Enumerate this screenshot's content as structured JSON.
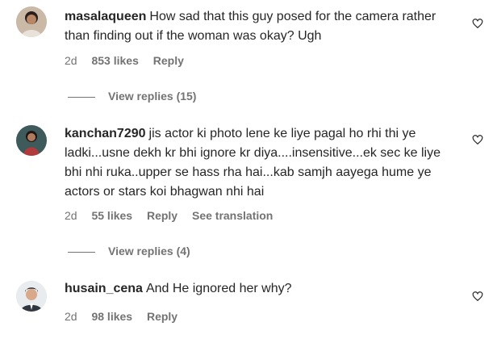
{
  "comments": [
    {
      "username": "masalaqueen",
      "text": "How sad that this guy posed for the camera rather than finding out if the woman was okay? Ugh",
      "time": "2d",
      "likes": "853 likes",
      "reply": "Reply",
      "translation": "",
      "view_replies": "View replies (15)"
    },
    {
      "username": "kanchan7290",
      "text": "jis actor ki photo lene ke liye pagal ho rhi thi ye ladki...usne dekh kr bhi ignore kr diya....insensitive...ek sec ke liye bhi nhi ruka..upper se hass rha hai...kab samjh aayega hume ye actors or stars koi bhagwan nhi hai",
      "time": "2d",
      "likes": "55 likes",
      "reply": "Reply",
      "translation": "See translation",
      "view_replies": "View replies (4)"
    },
    {
      "username": "husain_cena",
      "text": "And He ignored her why?",
      "time": "2d",
      "likes": "98 likes",
      "reply": "Reply",
      "translation": "",
      "view_replies": ""
    }
  ],
  "icons": {
    "like": "heart-outline-icon"
  }
}
